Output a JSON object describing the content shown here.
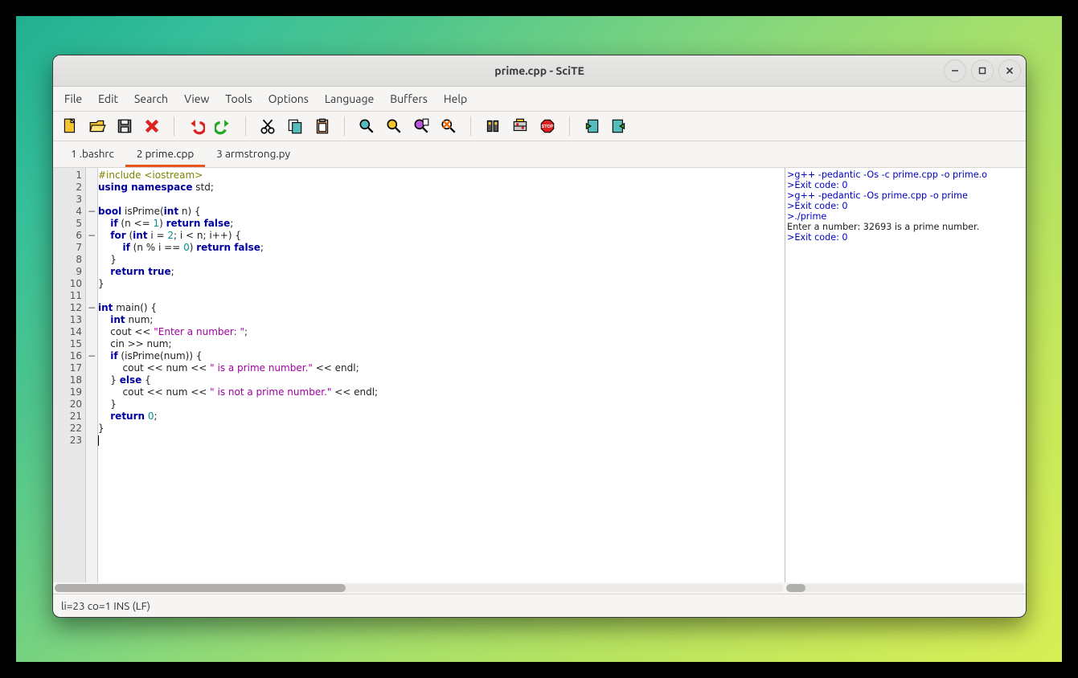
{
  "window": {
    "title": "prime.cpp - SciTE"
  },
  "menu": [
    "File",
    "Edit",
    "Search",
    "View",
    "Tools",
    "Options",
    "Language",
    "Buffers",
    "Help"
  ],
  "toolbar": [
    "new",
    "open",
    "save",
    "close",
    "|",
    "undo",
    "redo",
    "|",
    "cut",
    "copy",
    "paste",
    "|",
    "find",
    "find-next",
    "find-files",
    "replace",
    "|",
    "compile",
    "build",
    "stop",
    "|",
    "prev",
    "next"
  ],
  "tabs": [
    {
      "label": "1 .bashrc",
      "active": false
    },
    {
      "label": "2 prime.cpp",
      "active": true
    },
    {
      "label": "3 armstrong.py",
      "active": false
    }
  ],
  "line_numbers": [
    "1",
    "2",
    "3",
    "4",
    "5",
    "6",
    "7",
    "8",
    "9",
    "10",
    "11",
    "12",
    "13",
    "14",
    "15",
    "16",
    "17",
    "18",
    "19",
    "20",
    "21",
    "22",
    "23"
  ],
  "fold": [
    "",
    "",
    "",
    "-",
    "",
    "-",
    "",
    "",
    "",
    "",
    "",
    "-",
    "",
    "",
    "",
    "-",
    "",
    "",
    "",
    "",
    "",
    "",
    ""
  ],
  "code": [
    {
      "indent": 0,
      "tokens": [
        {
          "t": "#include <iostream>",
          "c": "k-preproc"
        }
      ]
    },
    {
      "indent": 0,
      "tokens": [
        {
          "t": "using namespace",
          "c": "k-key"
        },
        {
          "t": " std;",
          "c": "k-ident"
        }
      ]
    },
    {
      "indent": 0,
      "tokens": []
    },
    {
      "indent": 0,
      "tokens": [
        {
          "t": "bool",
          "c": "k-key"
        },
        {
          "t": " isPrime(",
          "c": "k-ident"
        },
        {
          "t": "int",
          "c": "k-key"
        },
        {
          "t": " n) {",
          "c": "k-ident"
        }
      ]
    },
    {
      "indent": 1,
      "tokens": [
        {
          "t": "if",
          "c": "k-key"
        },
        {
          "t": " (n <= ",
          "c": "k-ident"
        },
        {
          "t": "1",
          "c": "k-num"
        },
        {
          "t": ") ",
          "c": "k-ident"
        },
        {
          "t": "return false",
          "c": "k-key"
        },
        {
          "t": ";",
          "c": "k-ident"
        }
      ]
    },
    {
      "indent": 1,
      "tokens": [
        {
          "t": "for",
          "c": "k-key"
        },
        {
          "t": " (",
          "c": "k-ident"
        },
        {
          "t": "int",
          "c": "k-key"
        },
        {
          "t": " i = ",
          "c": "k-ident"
        },
        {
          "t": "2",
          "c": "k-num"
        },
        {
          "t": "; i < n; i++) {",
          "c": "k-ident"
        }
      ]
    },
    {
      "indent": 2,
      "tokens": [
        {
          "t": "if",
          "c": "k-key"
        },
        {
          "t": " (n % i == ",
          "c": "k-ident"
        },
        {
          "t": "0",
          "c": "k-num"
        },
        {
          "t": ") ",
          "c": "k-ident"
        },
        {
          "t": "return false",
          "c": "k-key"
        },
        {
          "t": ";",
          "c": "k-ident"
        }
      ]
    },
    {
      "indent": 1,
      "tokens": [
        {
          "t": "}",
          "c": "k-ident"
        }
      ]
    },
    {
      "indent": 1,
      "tokens": [
        {
          "t": "return true",
          "c": "k-key"
        },
        {
          "t": ";",
          "c": "k-ident"
        }
      ]
    },
    {
      "indent": 0,
      "tokens": [
        {
          "t": "}",
          "c": "k-ident"
        }
      ]
    },
    {
      "indent": 0,
      "tokens": []
    },
    {
      "indent": 0,
      "tokens": [
        {
          "t": "int",
          "c": "k-key"
        },
        {
          "t": " main() {",
          "c": "k-ident"
        }
      ]
    },
    {
      "indent": 1,
      "tokens": [
        {
          "t": "int",
          "c": "k-key"
        },
        {
          "t": " num;",
          "c": "k-ident"
        }
      ]
    },
    {
      "indent": 1,
      "tokens": [
        {
          "t": "cout << ",
          "c": "k-ident"
        },
        {
          "t": "\"Enter a number: \"",
          "c": "k-str"
        },
        {
          "t": ";",
          "c": "k-ident"
        }
      ]
    },
    {
      "indent": 1,
      "tokens": [
        {
          "t": "cin >> num;",
          "c": "k-ident"
        }
      ]
    },
    {
      "indent": 1,
      "tokens": [
        {
          "t": "if",
          "c": "k-key"
        },
        {
          "t": " (isPrime(num)) {",
          "c": "k-ident"
        }
      ]
    },
    {
      "indent": 2,
      "tokens": [
        {
          "t": "cout << num << ",
          "c": "k-ident"
        },
        {
          "t": "\" is a prime number.\"",
          "c": "k-str"
        },
        {
          "t": " << endl;",
          "c": "k-ident"
        }
      ]
    },
    {
      "indent": 1,
      "tokens": [
        {
          "t": "} ",
          "c": "k-ident"
        },
        {
          "t": "else",
          "c": "k-key"
        },
        {
          "t": " {",
          "c": "k-ident"
        }
      ]
    },
    {
      "indent": 2,
      "tokens": [
        {
          "t": "cout << num << ",
          "c": "k-ident"
        },
        {
          "t": "\" is not a prime number.\"",
          "c": "k-str"
        },
        {
          "t": " << endl;",
          "c": "k-ident"
        }
      ]
    },
    {
      "indent": 1,
      "tokens": [
        {
          "t": "}",
          "c": "k-ident"
        }
      ]
    },
    {
      "indent": 1,
      "tokens": [
        {
          "t": "return",
          "c": "k-key"
        },
        {
          "t": " ",
          "c": "k-ident"
        },
        {
          "t": "0",
          "c": "k-num"
        },
        {
          "t": ";",
          "c": "k-ident"
        }
      ]
    },
    {
      "indent": 0,
      "tokens": [
        {
          "t": "}",
          "c": "k-ident"
        }
      ]
    },
    {
      "indent": 0,
      "tokens": [],
      "cursor": true
    }
  ],
  "output": [
    {
      "t": ">g++ -pedantic -Os -c prime.cpp -o prime.o",
      "c": "o-cmd"
    },
    {
      "t": ">Exit code: 0",
      "c": "o-cmd"
    },
    {
      "t": ">g++ -pedantic -Os prime.cpp -o prime",
      "c": "o-cmd"
    },
    {
      "t": ">Exit code: 0",
      "c": "o-cmd"
    },
    {
      "t": ">./prime",
      "c": "o-cmd"
    },
    {
      "t": "Enter a number: 32693 is a prime number.",
      "c": "o-plain"
    },
    {
      "t": ">Exit code: 0",
      "c": "o-cmd"
    }
  ],
  "status": "li=23 co=1 INS (LF)"
}
